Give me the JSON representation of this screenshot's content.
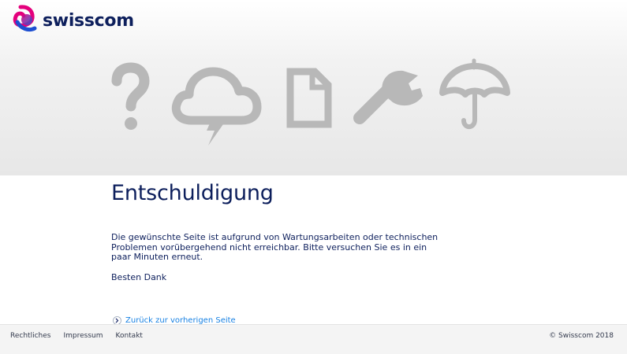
{
  "brand": {
    "name": "swisscom",
    "logo_icon": "swisscom-logo-icon"
  },
  "hero": {
    "icons": [
      "question-mark-icon",
      "thunder-cloud-icon",
      "document-icon",
      "wrench-icon",
      "umbrella-icon"
    ],
    "icon_color": "#b8b8b8"
  },
  "main": {
    "title": "Entschuldigung",
    "message": "Die gewünschte Seite ist aufgrund von Wartungsarbeiten oder technischen Problemen vorübergehend nicht erreichbar. Bitte versuchen Sie es in ein paar Minuten erneut.",
    "thanks": "Besten Dank",
    "back_link": "Zurück zur vorherigen Seite"
  },
  "footer": {
    "links": [
      "Rechtliches",
      "Impressum",
      "Kontakt"
    ],
    "copyright": "© Swisscom 2018"
  },
  "colors": {
    "brand_navy": "#0d1f5c",
    "link_blue": "#1781e3"
  }
}
